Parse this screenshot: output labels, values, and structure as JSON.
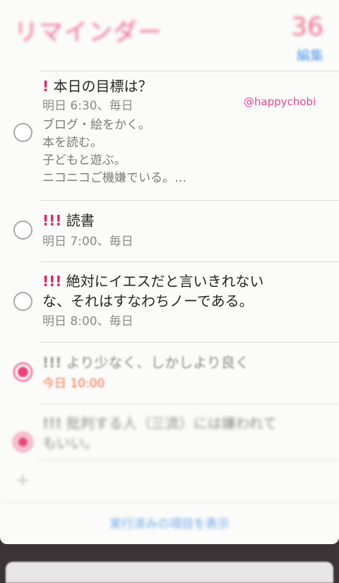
{
  "header": {
    "title": "リマインダー",
    "count": "36",
    "edit_label": "編集"
  },
  "watermark": "@happychobi",
  "reminders": [
    {
      "priority": "!",
      "title": "本日の目標は？",
      "due": "明日 6:30、毎日",
      "notes": "ブログ・絵をかく。\n本を読む。\n子どもと遊ぶ。\nニコニコご機嫌でいる。…",
      "completed": false
    },
    {
      "priority": "!!!",
      "title": "読書",
      "due": "明日 7:00、毎日",
      "completed": false
    },
    {
      "priority": "!!!",
      "title_line1": "絶対にイエスだと言いきれない",
      "title_line2": "な、それはすなわちノーである。",
      "due": "明日 8:00、毎日",
      "completed": false
    },
    {
      "priority": "!!!",
      "title": "より少なく、しかしより良く",
      "due": "今日 10:00",
      "completed": true
    },
    {
      "priority": "!!!",
      "title_line1": "批判する人（三流）には嫌われて",
      "title_line2": "もいい。",
      "completed": true
    }
  ],
  "add_icon": "plus-icon",
  "show_completed_label": "実行済みの項目を表示",
  "colors": {
    "accent_pink": "#f06f91",
    "priority_red": "#e8245f",
    "link_blue": "#5d9ee6",
    "today_orange": "#f2724e"
  }
}
